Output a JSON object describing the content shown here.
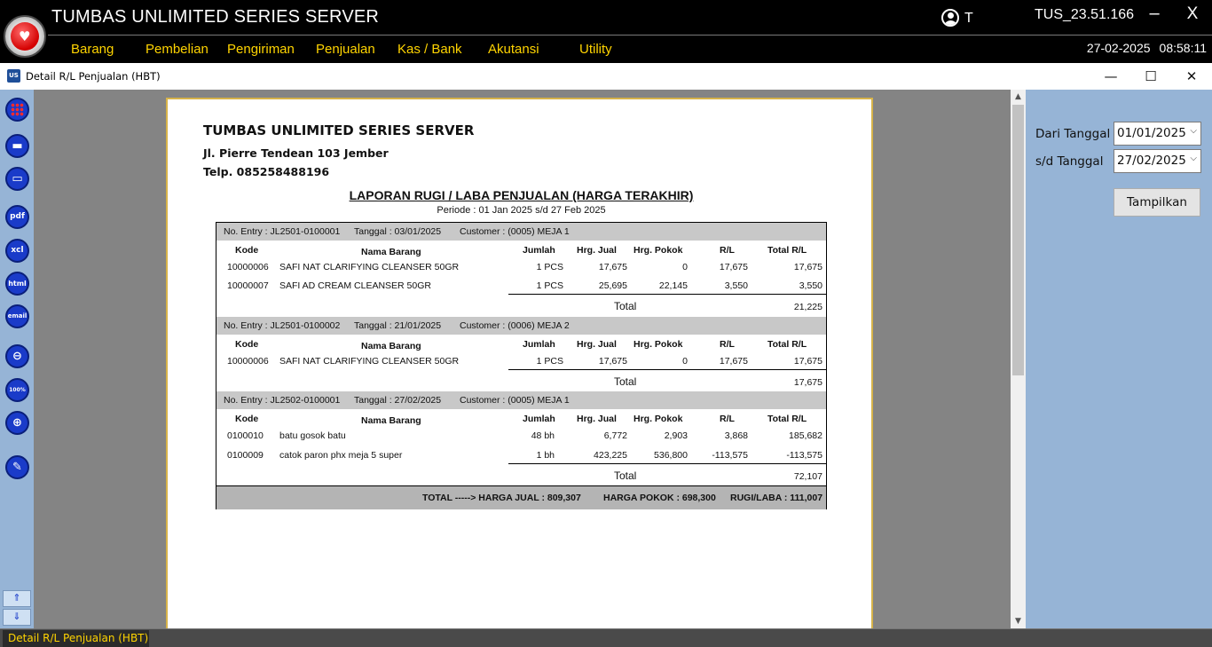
{
  "app": {
    "title": "TUMBAS UNLIMITED SERIES SERVER",
    "user": "T",
    "version": "TUS_23.51.166",
    "minimize": "–",
    "close": "X"
  },
  "menu": [
    "Barang",
    "Pembelian",
    "Pengiriman",
    "Penjualan",
    "Kas / Bank",
    "Akutansi",
    "Utility"
  ],
  "datetime": {
    "date": "27-02-2025",
    "time": "08:58:11"
  },
  "window": {
    "icon_text": "US",
    "title": "Detail R/L Penjualan (HBT)",
    "minimize": "—",
    "maximize": "☐",
    "close": "✕"
  },
  "toolbar": {
    "pdf": "pdf",
    "xcl": "xcl",
    "html": "html",
    "email": "email",
    "zoom100": "100%",
    "scroll_up": "⇑",
    "scroll_down": "⇓"
  },
  "report": {
    "company": "TUMBAS UNLIMITED SERIES SERVER",
    "address": "Jl. Pierre Tendean 103 Jember",
    "phone": "Telp. 085258488196",
    "title": "LAPORAN RUGI / LABA PENJUALAN (HARGA TERAKHIR)",
    "periode": "Periode : 01 Jan 2025  s/d  27 Feb 2025",
    "columns": [
      "Kode",
      "Nama Barang",
      "Jumlah",
      "Hrg. Jual",
      "Hrg. Pokok",
      "R/L",
      "Total R/L"
    ],
    "total_label": "Total",
    "groups": [
      {
        "entry": "No. Entry  : JL2501-0100001",
        "tanggal": "Tanggal  : 03/01/2025",
        "customer": "Customer  : (0005) MEJA 1",
        "rows": [
          [
            "10000006",
            "SAFI NAT CLARIFYING CLEANSER 50GR",
            "1 PCS",
            "17,675",
            "0",
            "17,675",
            "17,675"
          ],
          [
            "10000007",
            "SAFI AD CREAM CLEANSER 50GR",
            "1 PCS",
            "25,695",
            "22,145",
            "3,550",
            "3,550"
          ]
        ],
        "total": "21,225"
      },
      {
        "entry": "No. Entry  : JL2501-0100002",
        "tanggal": "Tanggal  : 21/01/2025",
        "customer": "Customer  : (0006) MEJA 2",
        "rows": [
          [
            "10000006",
            "SAFI NAT CLARIFYING CLEANSER 50GR",
            "1 PCS",
            "17,675",
            "0",
            "17,675",
            "17,675"
          ]
        ],
        "total": "17,675"
      },
      {
        "entry": "No. Entry  : JL2502-0100001",
        "tanggal": "Tanggal  : 27/02/2025",
        "customer": "Customer  : (0005) MEJA 1",
        "rows": [
          [
            "0100010",
            "batu gosok batu",
            "48 bh",
            "6,772",
            "2,903",
            "3,868",
            "185,682"
          ],
          [
            "0100009",
            "catok paron phx meja 5 super",
            "1 bh",
            "423,225",
            "536,800",
            "-113,575",
            "-113,575"
          ]
        ],
        "total": "72,107"
      }
    ],
    "footer": {
      "harga_jual": "TOTAL -----> HARGA JUAL : 809,307",
      "harga_pokok": "HARGA POKOK :  698,300",
      "rugi_laba": "RUGI/LABA : 111,007"
    }
  },
  "filter": {
    "dari_label": "Dari Tanggal",
    "dari_value": "01/01/2025",
    "sd_label": "s/d Tanggal",
    "sd_value": "27/02/2025",
    "button": "Tampilkan"
  },
  "status": {
    "tab": "Detail R/L Penjualan (HBT)"
  }
}
